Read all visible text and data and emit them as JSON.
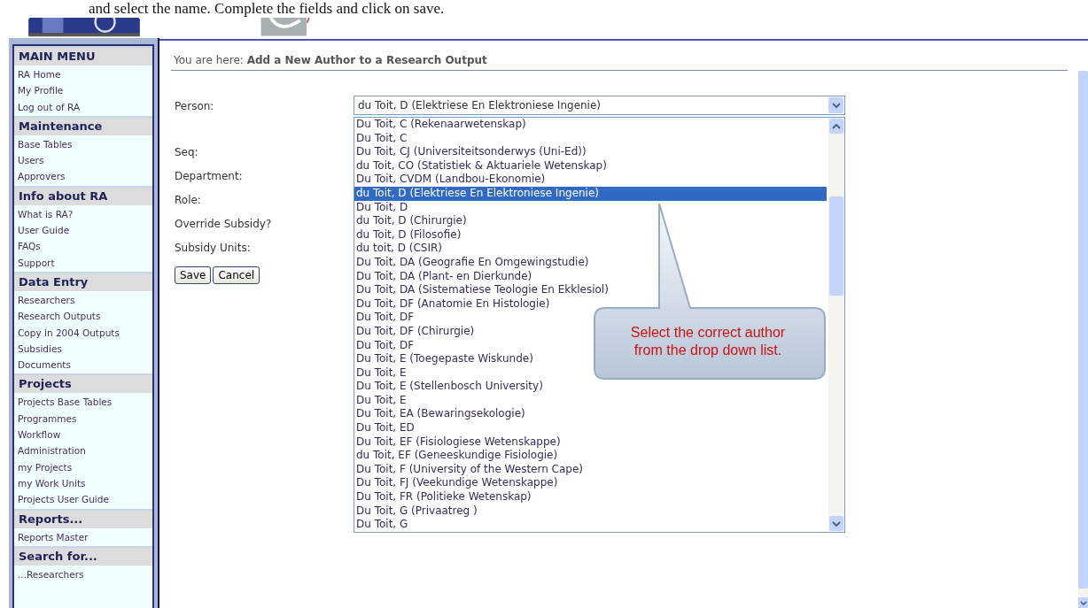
{
  "document_text": "and select the name. Complete the fields and click on save.",
  "sidebar": [
    {
      "title": "MAIN MENU",
      "items": [
        "RA Home",
        "My Profile",
        "Log out of RA"
      ]
    },
    {
      "title": "Maintenance",
      "items": [
        "Base Tables",
        "Users",
        "Approvers"
      ]
    },
    {
      "title": "Info about RA",
      "items": [
        "What is RA?",
        "User Guide",
        "FAQs",
        "Support"
      ]
    },
    {
      "title": "Data Entry",
      "items": [
        "Researchers",
        "Research Outputs",
        "Copy in 2004 Outputs",
        "Subsidies",
        "Documents"
      ]
    },
    {
      "title": "Projects",
      "items": [
        "Projects Base Tables",
        "Programmes",
        "Workflow\nAdministration",
        "my Projects",
        "my Work Units",
        "Projects User Guide"
      ]
    },
    {
      "title": "Reports...",
      "items": [
        "Reports Master"
      ]
    },
    {
      "title": "Search for...",
      "items": [
        "...Researchers"
      ]
    }
  ],
  "breadcrumb": {
    "label": "You are here:",
    "value": "Add a New Author to a Research Output"
  },
  "form": {
    "labels": [
      "Person:",
      "Seq:",
      "Department:",
      "Role:",
      "Override Subsidy?",
      "Subsidy Units:"
    ],
    "person": {
      "value": "du Toit, D (Elektriese En Elektroniese Ingenie)",
      "options": [
        {
          "label": "Du Toit, C (Rekenaarwetenskap)",
          "selected": false
        },
        {
          "label": "Du Toit, C",
          "selected": false
        },
        {
          "label": "Du Toit, CJ (Universiteitsonderwys (Uni-Ed))",
          "selected": false
        },
        {
          "label": "du Toit, CO (Statistiek & Aktuariele Wetenskap)",
          "selected": false
        },
        {
          "label": "Du Toit, CVDM (Landbou-Ekonomie)",
          "selected": false
        },
        {
          "label": "du Toit, D (Elektriese En Elektroniese Ingenie)",
          "selected": true
        },
        {
          "label": "Du Toit, D",
          "selected": false
        },
        {
          "label": "du Toit, D (Chirurgie)",
          "selected": false
        },
        {
          "label": "du Toit, D (Filosofie)",
          "selected": false
        },
        {
          "label": "du toit, D (CSIR)",
          "selected": false
        },
        {
          "label": "Du Toit, DA (Geografie En Omgewingstudie)",
          "selected": false
        },
        {
          "label": "Du Toit, DA (Plant- en Dierkunde)",
          "selected": false
        },
        {
          "label": "Du Toit, DA (Sistematiese Teologie En Ekklesiol)",
          "selected": false
        },
        {
          "label": "Du Toit, DF (Anatomie En Histologie)",
          "selected": false
        },
        {
          "label": "Du Toit, DF",
          "selected": false
        },
        {
          "label": "Du Toit, DF (Chirurgie)",
          "selected": false
        },
        {
          "label": "Du Toit, DF",
          "selected": false
        },
        {
          "label": "Du Toit, E (Toegepaste Wiskunde)",
          "selected": false
        },
        {
          "label": "Du Toit, E",
          "selected": false
        },
        {
          "label": "Du Toit, E (Stellenbosch University)",
          "selected": false
        },
        {
          "label": "Du Toit, E",
          "selected": false
        },
        {
          "label": "Du Toit, EA (Bewaringsekologie)",
          "selected": false
        },
        {
          "label": "Du Toit, ED",
          "selected": false
        },
        {
          "label": "Du Toit, EF (Fisiologiese Wetenskappe)",
          "selected": false
        },
        {
          "label": "du Toit, EF (Geneeskundige Fisiologie)",
          "selected": false
        },
        {
          "label": "Du Toit, F (University of the Western Cape)",
          "selected": false
        },
        {
          "label": "Du Toit, FJ (Veekundige Wetenskappe)",
          "selected": false
        },
        {
          "label": "Du Toit, FR (Politieke Wetenskap)",
          "selected": false
        },
        {
          "label": "Du Toit, G (Privaatreg )",
          "selected": false
        },
        {
          "label": "Du Toit, G",
          "selected": false
        }
      ]
    },
    "buttons": [
      "Save",
      "Cancel"
    ]
  },
  "callout": "Select the correct author from the drop down list."
}
